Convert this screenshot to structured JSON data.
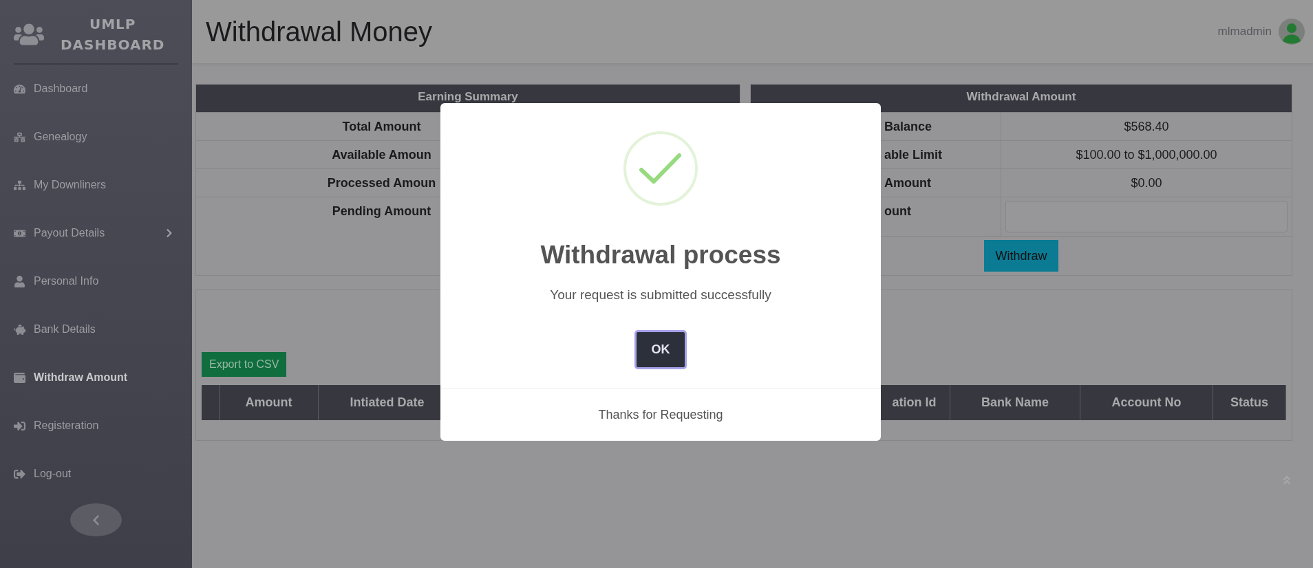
{
  "sidebar": {
    "brand": [
      "UMLP",
      "DASHBOARD"
    ],
    "items": [
      {
        "label": "Dashboard",
        "selected": false,
        "submenu": false
      },
      {
        "label": "Genealogy",
        "selected": false,
        "submenu": false
      },
      {
        "label": "My Downliners",
        "selected": false,
        "submenu": false
      },
      {
        "label": "Payout Details",
        "selected": false,
        "submenu": true
      },
      {
        "label": "Personal Info",
        "selected": false,
        "submenu": false
      },
      {
        "label": "Bank Details",
        "selected": false,
        "submenu": false
      },
      {
        "label": "Withdraw Amount",
        "selected": true,
        "submenu": false
      },
      {
        "label": "Registeration",
        "selected": false,
        "submenu": false
      },
      {
        "label": "Log-out",
        "selected": false,
        "submenu": false
      }
    ]
  },
  "header": {
    "title": "Withdrawal Money",
    "user": "mlmadmin"
  },
  "earning_summary": {
    "title": "Earning Summary",
    "rows": [
      "Total Amount",
      "Available Amoun",
      "Processed Amoun",
      "Pending Amount"
    ]
  },
  "withdrawal_amount": {
    "title": "Withdrawal Amount",
    "rows": [
      {
        "label": "Balance",
        "value": "$568.40"
      },
      {
        "label": "able Limit",
        "value": "$100.00 to $1,000,000.00"
      },
      {
        "label": "Amount",
        "value": "$0.00"
      }
    ],
    "input_label": "ount",
    "button": "Withdraw"
  },
  "history": {
    "export_button": "Export to CSV",
    "columns": [
      "Amount",
      "Intiated Date",
      "ation Id",
      "Bank Name",
      "Account No",
      "Status"
    ]
  },
  "dialog": {
    "title": "Withdrawal process",
    "message": "Your request is submitted successfully",
    "button": "OK",
    "footer": "Thanks for Requesting"
  }
}
